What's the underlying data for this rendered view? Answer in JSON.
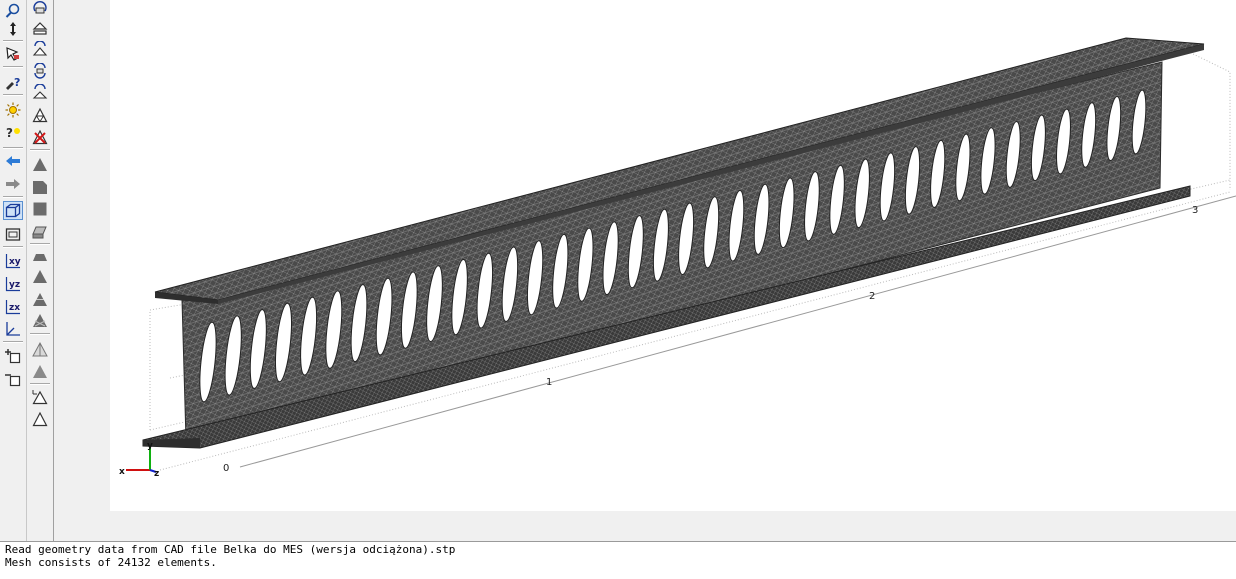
{
  "toolbar_left": {
    "tools": [
      {
        "icon": "zoom-icon",
        "active": false
      },
      {
        "icon": "pan-icon",
        "active": false
      },
      {
        "icon": "select-pointer-icon",
        "active": false
      },
      {
        "icon": "query-icon",
        "active": false
      },
      {
        "icon": "light-icon",
        "active": false
      },
      {
        "icon": "hint-icon",
        "active": false
      },
      {
        "icon": "arrow-left-icon",
        "active": false
      },
      {
        "icon": "arrow-right-icon",
        "active": false
      },
      {
        "icon": "perspective-view-icon",
        "active": true
      },
      {
        "icon": "front-view-icon",
        "active": false
      },
      {
        "icon": "plane-xy-icon",
        "label": "xy",
        "active": false
      },
      {
        "icon": "plane-yz-icon",
        "label": "yz",
        "active": false
      },
      {
        "icon": "plane-zx-icon",
        "label": "zx",
        "active": false
      },
      {
        "icon": "axes-icon",
        "active": false
      },
      {
        "icon": "add-window-icon",
        "active": false
      },
      {
        "icon": "remove-window-icon",
        "active": false
      }
    ]
  },
  "toolbar_right": {
    "tools": [
      {
        "icon": "rotate-icon"
      },
      {
        "icon": "eject-icon"
      },
      {
        "icon": "rotate-mesh-icon"
      },
      {
        "icon": "refresh-mesh-icon"
      },
      {
        "icon": "mesh-cycle-icon"
      },
      {
        "icon": "mesh-triangle-icon"
      },
      {
        "icon": "mesh-delete-icon"
      },
      {
        "icon": "solid-triangle-icon"
      },
      {
        "icon": "face-icon"
      },
      {
        "icon": "solid-square-icon"
      },
      {
        "icon": "shaded-body-icon"
      },
      {
        "icon": "solid-dome-icon"
      },
      {
        "icon": "triangle-shaded-icon"
      },
      {
        "icon": "triangle-split-icon"
      },
      {
        "icon": "triangle-cross-icon"
      },
      {
        "icon": "triangle-outline-shaded-icon"
      },
      {
        "icon": "triangle-gray-icon"
      },
      {
        "icon": "triangle-wire-xy-icon"
      },
      {
        "icon": "triangle-wire-icon"
      }
    ]
  },
  "viewport": {
    "axis_ticks": [
      "0",
      "1",
      "2",
      "3"
    ],
    "triad": {
      "x": "x",
      "y": "y",
      "z": "z"
    },
    "colors": {
      "mesh_fill": "#4a4a4a",
      "mesh_line": "#9a9a9a",
      "background": "#ffffff",
      "x_axis": "#d01010",
      "y_axis": "#10b010",
      "z_axis": "#1020d0"
    }
  },
  "console": {
    "lines": [
      "Read geometry data from CAD file Belka do MES (wersja odciążona).stp",
      "Mesh consists of 24132 elements."
    ]
  }
}
